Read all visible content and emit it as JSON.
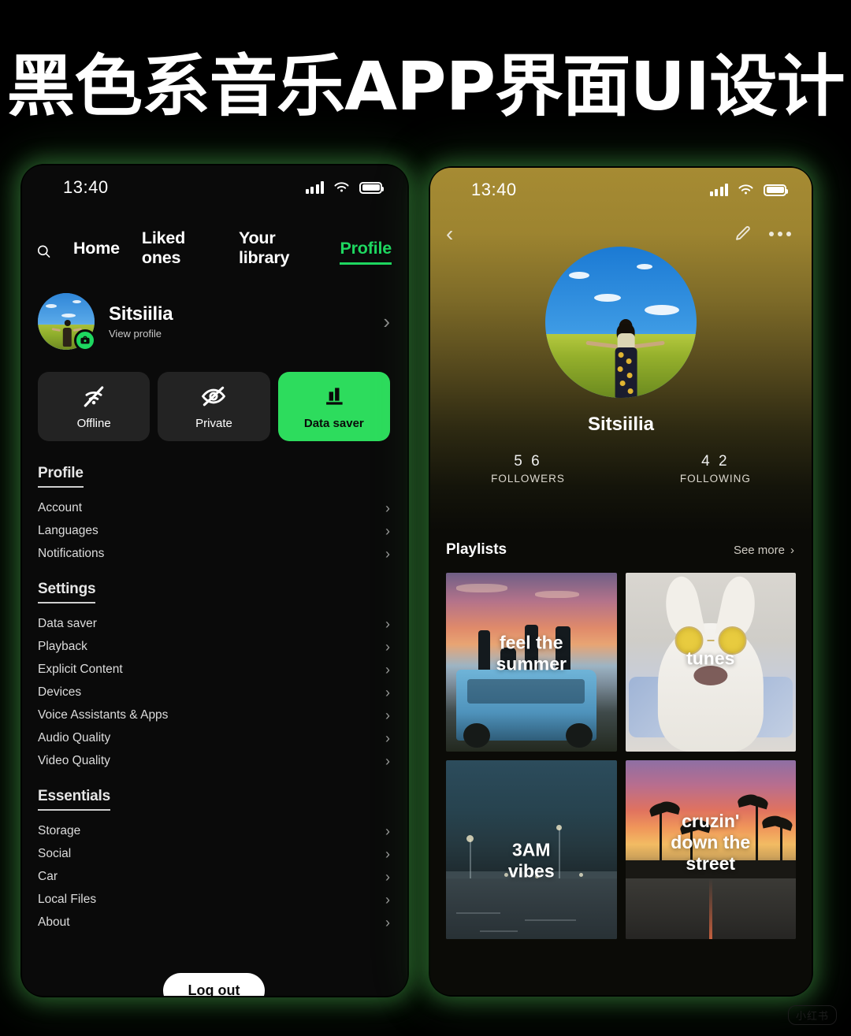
{
  "title": {
    "text": "黑色系音乐APP界面UI设计"
  },
  "watermark": {
    "text": "小红书"
  },
  "left_phone": {
    "statusbar": {
      "time": "13:40"
    },
    "nav": {
      "search_icon": "search-icon",
      "tabs": [
        {
          "label": "Home",
          "active": false
        },
        {
          "label": "Liked ones",
          "active": false
        },
        {
          "label": "Your library",
          "active": false
        },
        {
          "label": "Profile",
          "active": true
        }
      ]
    },
    "profile": {
      "name": "Sitsiilia",
      "subtitle": "View profile",
      "badge_icon": "camera-icon",
      "chevron": "›"
    },
    "toggles": [
      {
        "label": "Offline",
        "icon": "wifi-off-icon",
        "active": false
      },
      {
        "label": "Private",
        "icon": "eye-off-icon",
        "active": false
      },
      {
        "label": "Data saver",
        "icon": "bar-chart-icon",
        "active": true
      }
    ],
    "sections": [
      {
        "heading": "Profile",
        "items": [
          "Account",
          "Languages",
          "Notifications"
        ]
      },
      {
        "heading": "Settings",
        "items": [
          "Data saver",
          "Playback",
          "Explicit Content",
          "Devices",
          "Voice Assistants & Apps",
          "Audio Quality",
          "Video Quality"
        ]
      },
      {
        "heading": "Essentials",
        "items": [
          "Storage",
          "Social",
          "Car",
          "Local Files",
          "About"
        ]
      }
    ],
    "logout_label": "Log out"
  },
  "right_phone": {
    "statusbar": {
      "time": "13:40"
    },
    "header": {
      "back_icon": "chevron-left-icon",
      "edit_icon": "pencil-icon",
      "more_icon": "more-horizontal-icon"
    },
    "profile": {
      "name": "Sitsiilia",
      "avatar_alt": "woman-in-flower-field-avatar"
    },
    "stats": [
      {
        "value": "5 6",
        "label": "FOLLOWERS"
      },
      {
        "value": "4 2",
        "label": "FOLLOWING"
      }
    ],
    "playlists_section": {
      "title": "Playlists",
      "see_more_label": "See more",
      "see_more_chevron": "›"
    },
    "playlists": [
      {
        "title": "feel the\nsummer",
        "art": "sunset-jeep-friends"
      },
      {
        "title": "tunes",
        "art": "white-dog-yellow-glasses"
      },
      {
        "title": "3AM\nvibes",
        "art": "night-parking-lot"
      },
      {
        "title": "cruzin'\ndown the\nstreet",
        "art": "palm-street-sunset"
      }
    ]
  },
  "colors": {
    "accent_green": "#1ED760",
    "toggle_green": "#2DDC5D",
    "background": "#000000",
    "phone_bg": "#0A0A0A",
    "card_bg": "#232323"
  }
}
